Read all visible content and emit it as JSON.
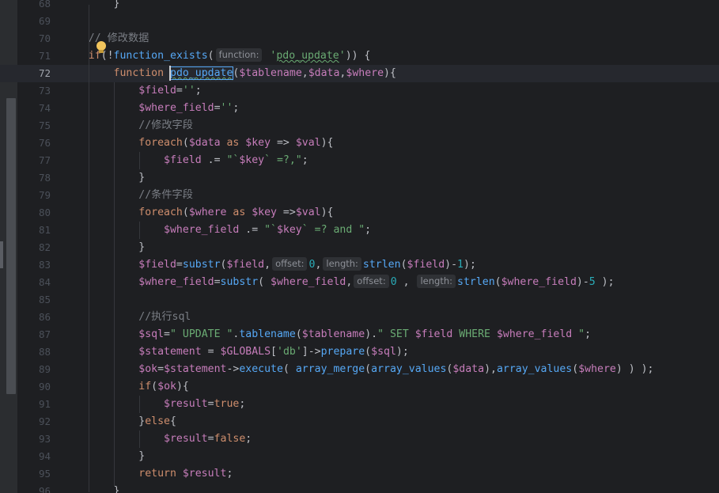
{
  "editor": {
    "current_line": "72",
    "lines": [
      {
        "n": "68",
        "current": false,
        "tokens": [
          {
            "t": "        }",
            "c": "txt"
          }
        ]
      },
      {
        "n": "69",
        "current": false,
        "tokens": []
      },
      {
        "n": "70",
        "current": false,
        "tokens": [
          {
            "t": "    // 修改数据",
            "c": "cmt"
          }
        ]
      },
      {
        "n": "71",
        "current": false,
        "tokens": [
          {
            "t": "    ",
            "c": "txt"
          },
          {
            "t": "if",
            "c": "kw"
          },
          {
            "t": "(!",
            "c": "txt"
          },
          {
            "t": "function_exists",
            "c": "fn"
          },
          {
            "t": "(",
            "c": "txt"
          },
          {
            "h": "function:"
          },
          {
            "t": " '",
            "c": "str"
          },
          {
            "t": "pdo_update",
            "c": "str",
            "u": true
          },
          {
            "t": "'",
            "c": "str"
          },
          {
            "t": ")) {",
            "c": "txt"
          }
        ]
      },
      {
        "n": "72",
        "current": true,
        "tokens": [
          {
            "t": "        ",
            "c": "txt"
          },
          {
            "t": "function ",
            "c": "kw"
          },
          {
            "t": "pdo_update",
            "c": "fn",
            "u": true,
            "box": true
          },
          {
            "t": "(",
            "c": "txt"
          },
          {
            "t": "$tablename",
            "c": "var"
          },
          {
            "t": ",",
            "c": "txt"
          },
          {
            "t": "$data",
            "c": "var"
          },
          {
            "t": ",",
            "c": "txt"
          },
          {
            "t": "$where",
            "c": "var"
          },
          {
            "t": "){",
            "c": "txt"
          }
        ]
      },
      {
        "n": "73",
        "current": false,
        "tokens": [
          {
            "t": "            ",
            "c": "txt"
          },
          {
            "t": "$field",
            "c": "var"
          },
          {
            "t": "=",
            "c": "txt"
          },
          {
            "t": "''",
            "c": "str"
          },
          {
            "t": ";",
            "c": "txt"
          }
        ]
      },
      {
        "n": "74",
        "current": false,
        "tokens": [
          {
            "t": "            ",
            "c": "txt"
          },
          {
            "t": "$where_field",
            "c": "var"
          },
          {
            "t": "=",
            "c": "txt"
          },
          {
            "t": "''",
            "c": "str"
          },
          {
            "t": ";",
            "c": "txt"
          }
        ]
      },
      {
        "n": "75",
        "current": false,
        "tokens": [
          {
            "t": "            //修改字段",
            "c": "cmt"
          }
        ]
      },
      {
        "n": "76",
        "current": false,
        "tokens": [
          {
            "t": "            ",
            "c": "txt"
          },
          {
            "t": "foreach",
            "c": "kw"
          },
          {
            "t": "(",
            "c": "txt"
          },
          {
            "t": "$data",
            "c": "var"
          },
          {
            "t": " as ",
            "c": "kw"
          },
          {
            "t": "$key",
            "c": "var"
          },
          {
            "t": " => ",
            "c": "txt"
          },
          {
            "t": "$val",
            "c": "var"
          },
          {
            "t": "){",
            "c": "txt"
          }
        ]
      },
      {
        "n": "77",
        "current": false,
        "tokens": [
          {
            "t": "                ",
            "c": "txt"
          },
          {
            "t": "$field",
            "c": "var"
          },
          {
            "t": " .= ",
            "c": "txt"
          },
          {
            "t": "\"`",
            "c": "str"
          },
          {
            "t": "$key",
            "c": "var"
          },
          {
            "t": "` =?,\"",
            "c": "str"
          },
          {
            "t": ";",
            "c": "txt"
          }
        ]
      },
      {
        "n": "78",
        "current": false,
        "tokens": [
          {
            "t": "            }",
            "c": "txt"
          }
        ]
      },
      {
        "n": "79",
        "current": false,
        "tokens": [
          {
            "t": "            //条件字段",
            "c": "cmt"
          }
        ]
      },
      {
        "n": "80",
        "current": false,
        "tokens": [
          {
            "t": "            ",
            "c": "txt"
          },
          {
            "t": "foreach",
            "c": "kw"
          },
          {
            "t": "(",
            "c": "txt"
          },
          {
            "t": "$where",
            "c": "var"
          },
          {
            "t": " as ",
            "c": "kw"
          },
          {
            "t": "$key",
            "c": "var"
          },
          {
            "t": " =>",
            "c": "txt"
          },
          {
            "t": "$val",
            "c": "var"
          },
          {
            "t": "){",
            "c": "txt"
          }
        ]
      },
      {
        "n": "81",
        "current": false,
        "tokens": [
          {
            "t": "                ",
            "c": "txt"
          },
          {
            "t": "$where_field",
            "c": "var"
          },
          {
            "t": " .= ",
            "c": "txt"
          },
          {
            "t": "\"`",
            "c": "str"
          },
          {
            "t": "$key",
            "c": "var"
          },
          {
            "t": "` =? and \"",
            "c": "str"
          },
          {
            "t": ";",
            "c": "txt"
          }
        ]
      },
      {
        "n": "82",
        "current": false,
        "tokens": [
          {
            "t": "            }",
            "c": "txt"
          }
        ]
      },
      {
        "n": "83",
        "current": false,
        "tokens": [
          {
            "t": "            ",
            "c": "txt"
          },
          {
            "t": "$field",
            "c": "var"
          },
          {
            "t": "=",
            "c": "txt"
          },
          {
            "t": "substr",
            "c": "fn"
          },
          {
            "t": "(",
            "c": "txt"
          },
          {
            "t": "$field",
            "c": "var"
          },
          {
            "t": ",",
            "c": "txt"
          },
          {
            "h": "offset:"
          },
          {
            "t": "0",
            "c": "num"
          },
          {
            "t": ",",
            "c": "txt"
          },
          {
            "h": "length:"
          },
          {
            "t": "strlen",
            "c": "fn"
          },
          {
            "t": "(",
            "c": "txt"
          },
          {
            "t": "$field",
            "c": "var"
          },
          {
            "t": ")-",
            "c": "txt"
          },
          {
            "t": "1",
            "c": "num"
          },
          {
            "t": ");",
            "c": "txt"
          }
        ]
      },
      {
        "n": "84",
        "current": false,
        "tokens": [
          {
            "t": "            ",
            "c": "txt"
          },
          {
            "t": "$where_field",
            "c": "var"
          },
          {
            "t": "=",
            "c": "txt"
          },
          {
            "t": "substr",
            "c": "fn"
          },
          {
            "t": "( ",
            "c": "txt"
          },
          {
            "t": "$where_field",
            "c": "var"
          },
          {
            "t": ",",
            "c": "txt"
          },
          {
            "h": "offset:"
          },
          {
            "t": "0",
            "c": "num"
          },
          {
            "t": " , ",
            "c": "txt"
          },
          {
            "h": "length:"
          },
          {
            "t": "strlen",
            "c": "fn"
          },
          {
            "t": "(",
            "c": "txt"
          },
          {
            "t": "$where_field",
            "c": "var"
          },
          {
            "t": ")-",
            "c": "txt"
          },
          {
            "t": "5",
            "c": "num"
          },
          {
            "t": " );",
            "c": "txt"
          }
        ]
      },
      {
        "n": "85",
        "current": false,
        "tokens": []
      },
      {
        "n": "86",
        "current": false,
        "tokens": [
          {
            "t": "            //执行sql",
            "c": "cmt"
          }
        ]
      },
      {
        "n": "87",
        "current": false,
        "tokens": [
          {
            "t": "            ",
            "c": "txt"
          },
          {
            "t": "$sql",
            "c": "var"
          },
          {
            "t": "=",
            "c": "txt"
          },
          {
            "t": "\" UPDATE \"",
            "c": "str"
          },
          {
            "t": ".",
            "c": "txt"
          },
          {
            "t": "tablename",
            "c": "fn"
          },
          {
            "t": "(",
            "c": "txt"
          },
          {
            "t": "$tablename",
            "c": "var"
          },
          {
            "t": ").",
            "c": "txt"
          },
          {
            "t": "\" SET ",
            "c": "str"
          },
          {
            "t": "$field",
            "c": "var"
          },
          {
            "t": " WHERE ",
            "c": "str"
          },
          {
            "t": "$where_field",
            "c": "var"
          },
          {
            "t": " \"",
            "c": "str"
          },
          {
            "t": ";",
            "c": "txt"
          }
        ]
      },
      {
        "n": "88",
        "current": false,
        "tokens": [
          {
            "t": "            ",
            "c": "txt"
          },
          {
            "t": "$statement",
            "c": "var"
          },
          {
            "t": " = ",
            "c": "txt"
          },
          {
            "t": "$GLOBALS",
            "c": "var"
          },
          {
            "t": "[",
            "c": "txt"
          },
          {
            "t": "'db'",
            "c": "str"
          },
          {
            "t": "]->",
            "c": "txt"
          },
          {
            "t": "prepare",
            "c": "fn"
          },
          {
            "t": "(",
            "c": "txt"
          },
          {
            "t": "$sql",
            "c": "var"
          },
          {
            "t": ");",
            "c": "txt"
          }
        ]
      },
      {
        "n": "89",
        "current": false,
        "tokens": [
          {
            "t": "            ",
            "c": "txt"
          },
          {
            "t": "$ok",
            "c": "var"
          },
          {
            "t": "=",
            "c": "txt"
          },
          {
            "t": "$statement",
            "c": "var"
          },
          {
            "t": "->",
            "c": "txt"
          },
          {
            "t": "execute",
            "c": "fn"
          },
          {
            "t": "( ",
            "c": "txt"
          },
          {
            "t": "array_merge",
            "c": "fn"
          },
          {
            "t": "(",
            "c": "txt"
          },
          {
            "t": "array_values",
            "c": "fn"
          },
          {
            "t": "(",
            "c": "txt"
          },
          {
            "t": "$data",
            "c": "var"
          },
          {
            "t": "),",
            "c": "txt"
          },
          {
            "t": "array_values",
            "c": "fn"
          },
          {
            "t": "(",
            "c": "txt"
          },
          {
            "t": "$where",
            "c": "var"
          },
          {
            "t": ") ) );",
            "c": "txt"
          }
        ]
      },
      {
        "n": "90",
        "current": false,
        "tokens": [
          {
            "t": "            ",
            "c": "txt"
          },
          {
            "t": "if",
            "c": "kw"
          },
          {
            "t": "(",
            "c": "txt"
          },
          {
            "t": "$ok",
            "c": "var"
          },
          {
            "t": "){",
            "c": "txt"
          }
        ]
      },
      {
        "n": "91",
        "current": false,
        "tokens": [
          {
            "t": "                ",
            "c": "txt"
          },
          {
            "t": "$result",
            "c": "var"
          },
          {
            "t": "=",
            "c": "txt"
          },
          {
            "t": "true",
            "c": "kw"
          },
          {
            "t": ";",
            "c": "txt"
          }
        ]
      },
      {
        "n": "92",
        "current": false,
        "tokens": [
          {
            "t": "            }",
            "c": "txt"
          },
          {
            "t": "else",
            "c": "kw"
          },
          {
            "t": "{",
            "c": "txt"
          }
        ]
      },
      {
        "n": "93",
        "current": false,
        "tokens": [
          {
            "t": "                ",
            "c": "txt"
          },
          {
            "t": "$result",
            "c": "var"
          },
          {
            "t": "=",
            "c": "txt"
          },
          {
            "t": "false",
            "c": "kw"
          },
          {
            "t": ";",
            "c": "txt"
          }
        ]
      },
      {
        "n": "94",
        "current": false,
        "tokens": [
          {
            "t": "            }",
            "c": "txt"
          }
        ]
      },
      {
        "n": "95",
        "current": false,
        "tokens": [
          {
            "t": "            ",
            "c": "txt"
          },
          {
            "t": "return ",
            "c": "kw"
          },
          {
            "t": "$result",
            "c": "var"
          },
          {
            "t": ";",
            "c": "txt"
          }
        ]
      },
      {
        "n": "96",
        "current": false,
        "tokens": [
          {
            "t": "        }",
            "c": "txt"
          }
        ]
      }
    ]
  },
  "icons": {
    "intention_bulb": "lightbulb-icon"
  },
  "colors": {
    "background": "#1e1f22",
    "keyword": "#cf8e6d",
    "variable": "#c77dbb",
    "function": "#56a8f5",
    "string": "#6aab73",
    "comment": "#7a7e85",
    "number": "#2aacb8"
  }
}
